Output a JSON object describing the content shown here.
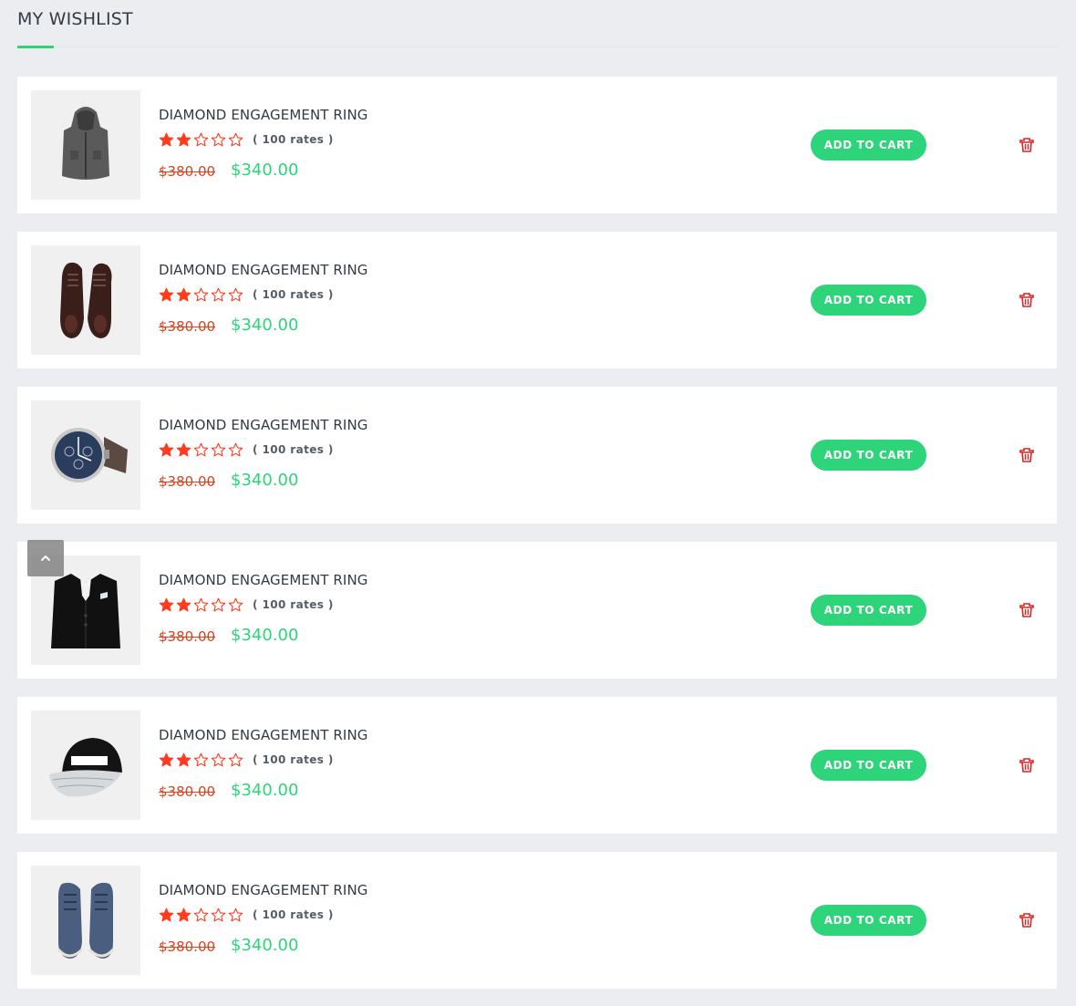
{
  "page": {
    "title": "MY WISHLIST"
  },
  "colors": {
    "accent_green": "#2ed47a",
    "old_price_red": "#d9421f",
    "star_red": "#ff3c1f",
    "trash_red": "#e02424"
  },
  "wishlist": {
    "items": [
      {
        "name": "DIAMOND ENGAGEMENT RING",
        "rating": 2,
        "rating_max": 5,
        "rates_label": "( 100 rates )",
        "old_price": "$380.00",
        "price": "$340.00",
        "button_label": "ADD TO CART",
        "image_icon": "hooded-vest-icon"
      },
      {
        "name": "DIAMOND ENGAGEMENT RING",
        "rating": 2,
        "rating_max": 5,
        "rates_label": "( 100 rates )",
        "old_price": "$380.00",
        "price": "$340.00",
        "button_label": "ADD TO CART",
        "image_icon": "dress-shoes-icon"
      },
      {
        "name": "DIAMOND ENGAGEMENT RING",
        "rating": 2,
        "rating_max": 5,
        "rates_label": "( 100 rates )",
        "old_price": "$380.00",
        "price": "$340.00",
        "button_label": "ADD TO CART",
        "image_icon": "wristwatch-icon"
      },
      {
        "name": "DIAMOND ENGAGEMENT RING",
        "rating": 2,
        "rating_max": 5,
        "rates_label": "( 100 rates )",
        "old_price": "$380.00",
        "price": "$340.00",
        "button_label": "ADD TO CART",
        "image_icon": "blazer-icon"
      },
      {
        "name": "DIAMOND ENGAGEMENT RING",
        "rating": 2,
        "rating_max": 5,
        "rates_label": "( 100 rates )",
        "old_price": "$380.00",
        "price": "$340.00",
        "button_label": "ADD TO CART",
        "image_icon": "snapback-cap-icon"
      },
      {
        "name": "DIAMOND ENGAGEMENT RING",
        "rating": 2,
        "rating_max": 5,
        "rates_label": "( 100 rates )",
        "old_price": "$380.00",
        "price": "$340.00",
        "button_label": "ADD TO CART",
        "image_icon": "suede-boots-icon"
      }
    ]
  },
  "controls": {
    "scroll_top_icon": "chevron-up-icon",
    "delete_icon": "trash-icon"
  }
}
